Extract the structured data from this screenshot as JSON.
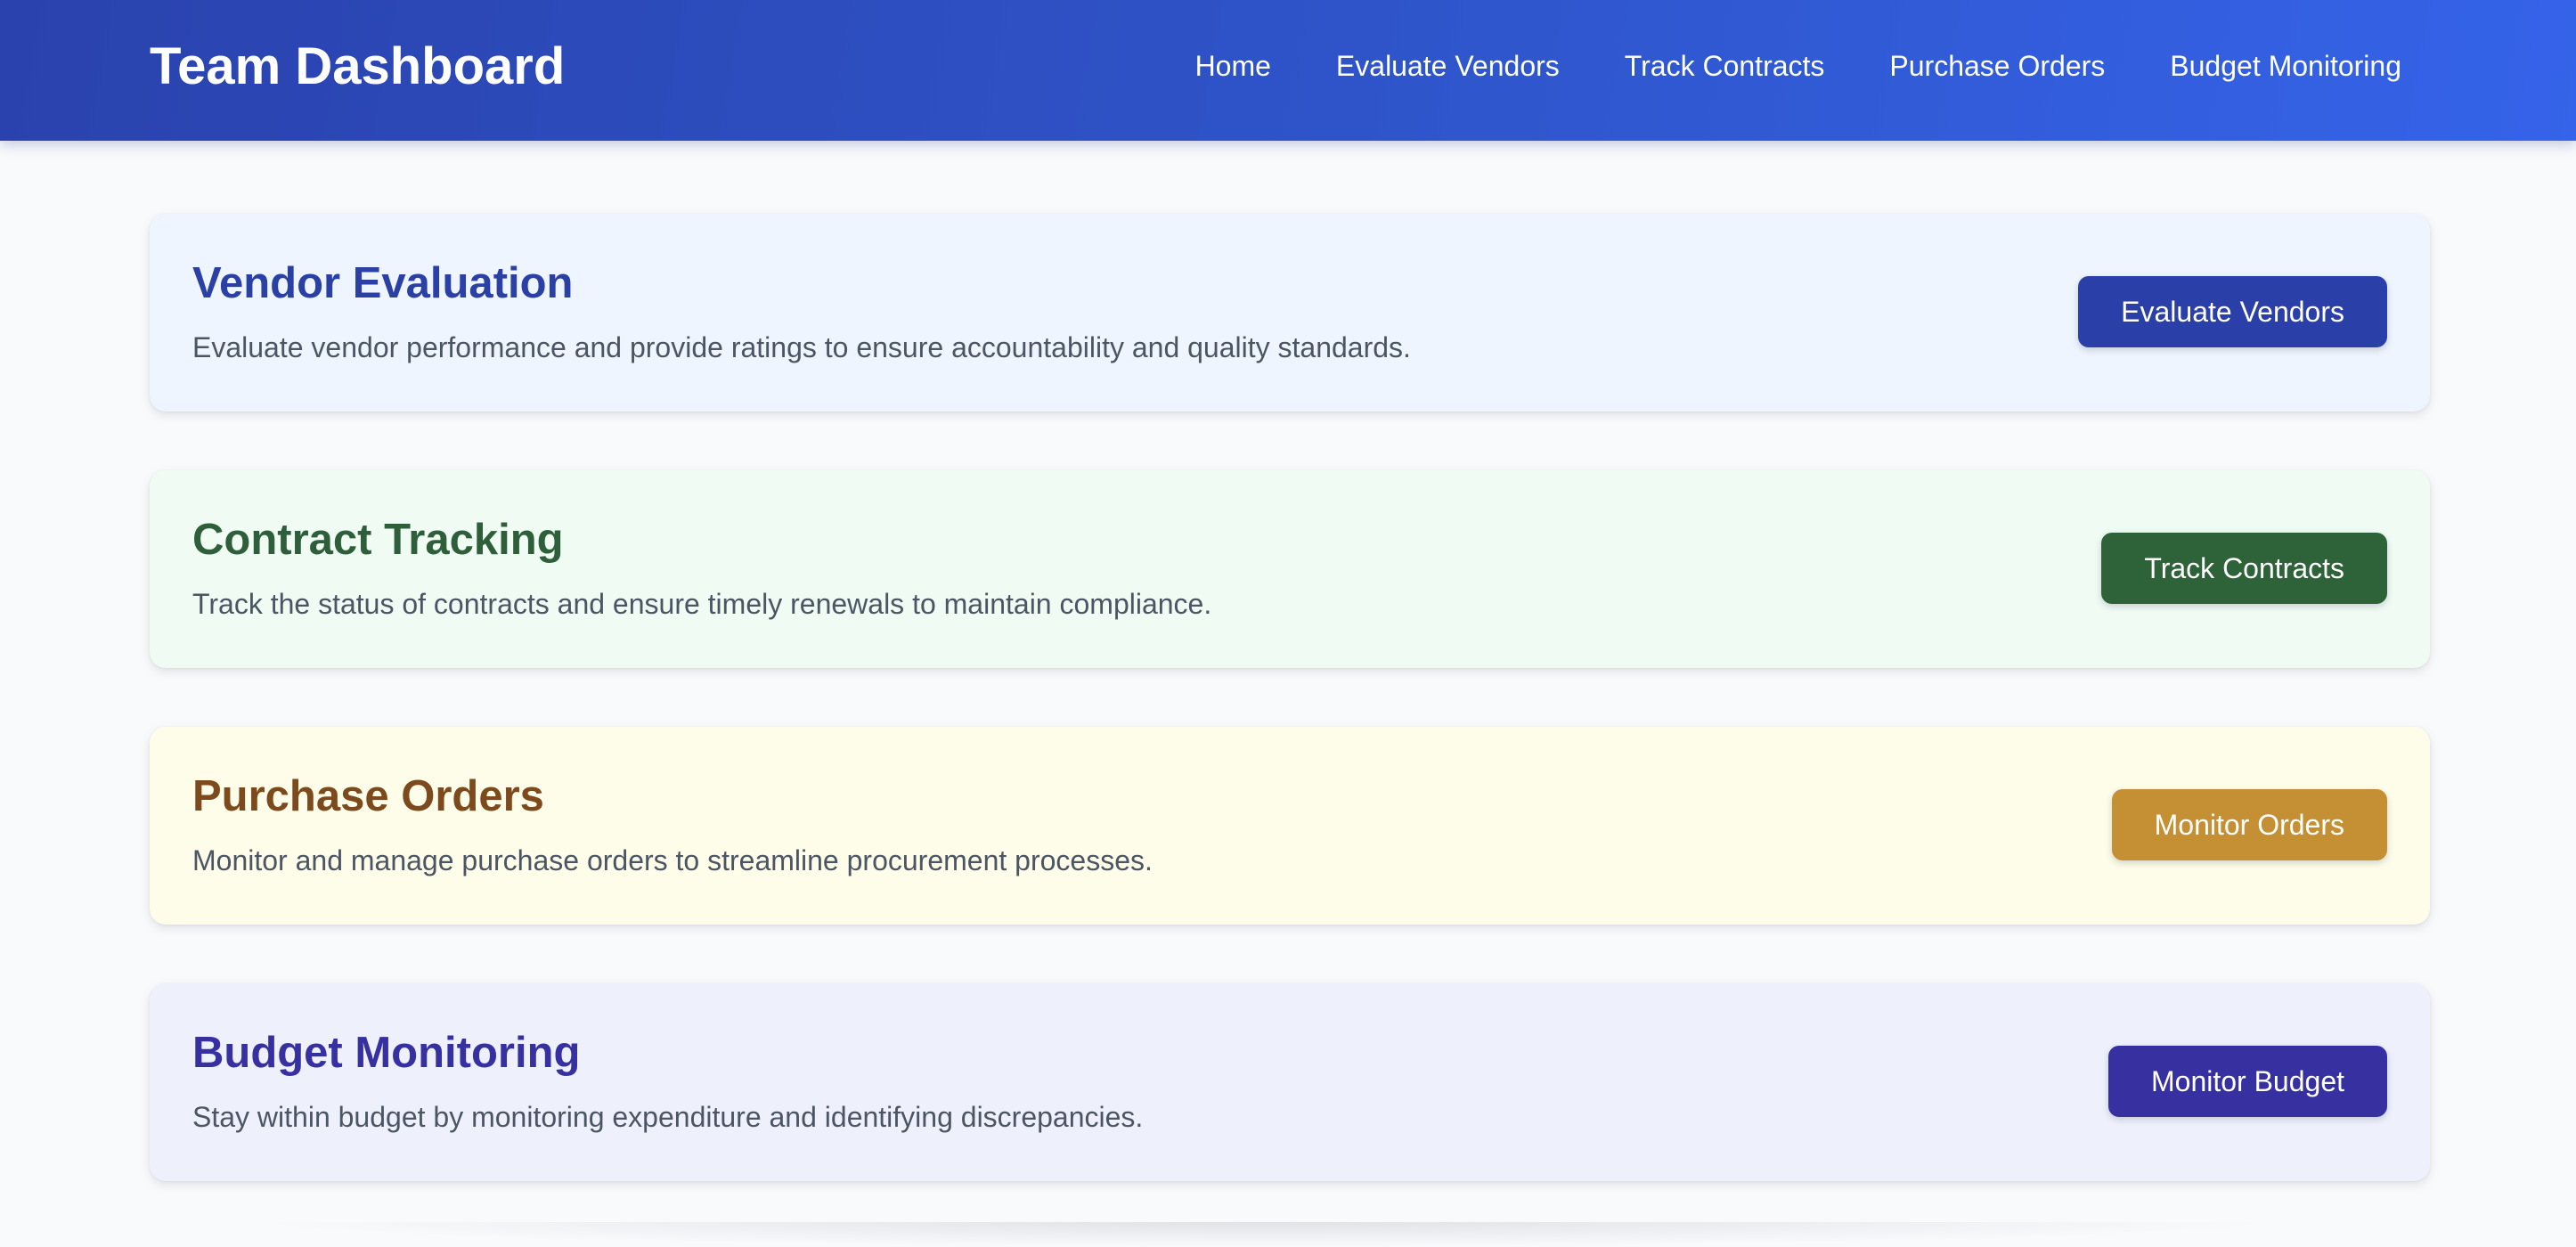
{
  "header": {
    "title": "Team Dashboard",
    "nav": [
      "Home",
      "Evaluate Vendors",
      "Track Contracts",
      "Purchase Orders",
      "Budget Monitoring"
    ]
  },
  "cards": [
    {
      "title": "Vendor Evaluation",
      "description": "Evaluate vendor performance and provide ratings to ensure accountability and quality standards.",
      "button": "Evaluate Vendors",
      "accent": "#2b3fa8"
    },
    {
      "title": "Contract Tracking",
      "description": "Track the status of contracts and ensure timely renewals to maintain compliance.",
      "button": "Track Contracts",
      "accent": "#2e6239"
    },
    {
      "title": "Purchase Orders",
      "description": "Monitor and manage purchase orders to streamline procurement processes.",
      "button": "Monitor Orders",
      "accent": "#c58f33"
    },
    {
      "title": "Budget Monitoring",
      "description": "Stay within budget by monitoring expenditure and identifying discrepancies.",
      "button": "Monitor Budget",
      "accent": "#3730a0"
    }
  ],
  "colors": {
    "header_gradient_start": "#2a42ad",
    "header_gradient_end": "#3563e9",
    "page_background": "#f8fafc",
    "description_text": "#4b5563"
  }
}
